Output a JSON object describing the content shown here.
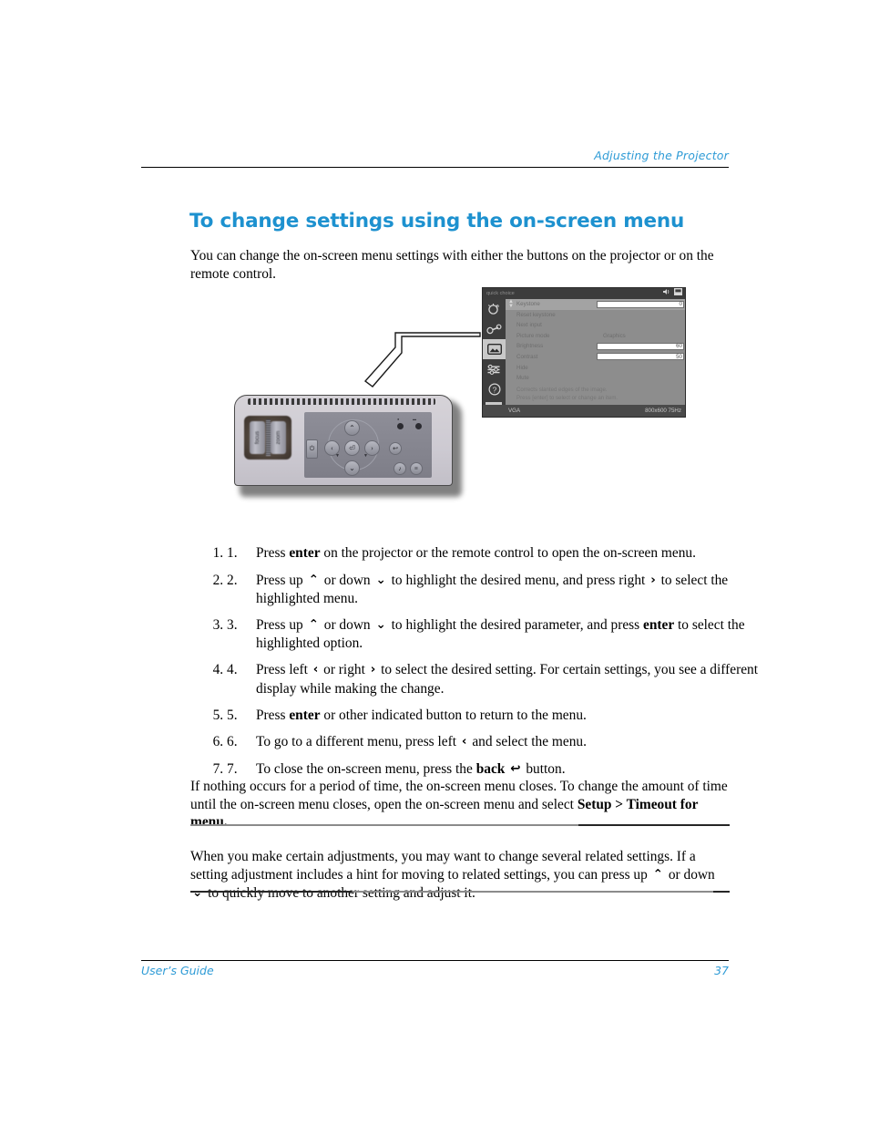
{
  "header": {
    "running_head": "Adjusting the Projector"
  },
  "section": {
    "title": "To change settings using the on-screen menu",
    "intro": "You can change the on-screen menu settings with either the buttons on the projector or on the remote control."
  },
  "figure": {
    "osd": {
      "title": "quick choice",
      "status_source": "VGA",
      "status_mode": "800x600 75Hz",
      "hint_line1": "Corrects slanted edges of the image.",
      "hint_line2": "Press [enter] to select or change an item.",
      "sidebar_icons": [
        "quick-choice-icon",
        "adjust-picture-icon",
        "picture-icon",
        "setup-icon",
        "help-icon",
        "hp-logo-icon"
      ],
      "titlebar_icons": [
        "volume-icon",
        "input-icon"
      ],
      "rows": [
        {
          "label": "Keystone",
          "type": "bar",
          "value": "0",
          "highlighted": true
        },
        {
          "label": "Reset keystone",
          "type": "none",
          "value": ""
        },
        {
          "label": "Next input",
          "type": "none",
          "value": ""
        },
        {
          "label": "Picture mode",
          "type": "option",
          "value": "Graphics"
        },
        {
          "label": "Brightness",
          "type": "bar",
          "value": "60"
        },
        {
          "label": "Contrast",
          "type": "bar",
          "value": "50"
        },
        {
          "label": "Hide",
          "type": "none",
          "value": ""
        },
        {
          "label": "Mute",
          "type": "none",
          "value": ""
        }
      ]
    },
    "projector": {
      "focus_label": "focus",
      "zoom_label": "zoom",
      "keystone_left_label": "▼",
      "keystone_right_label": "▼",
      "led_label_1": "●",
      "led_label_2": "▬",
      "power_button": "⏻",
      "up_button": "⌃",
      "down_button": "⌄",
      "left_button": "‹",
      "right_button": "›",
      "enter_button": "⏎",
      "back_button": "↩",
      "button_1": "♪",
      "button_2": "≡"
    }
  },
  "steps": [
    {
      "num": "1.",
      "parts": [
        {
          "t": "Press "
        },
        {
          "t": "enter",
          "bold": true
        },
        {
          "t": " on the projector or the remote control to open the on-screen menu."
        }
      ]
    },
    {
      "num": "2.",
      "parts": [
        {
          "t": "Press up "
        },
        {
          "t": "⌃",
          "glyph": "up-chevron-icon"
        },
        {
          "t": " or down "
        },
        {
          "t": "⌄",
          "glyph": "down-chevron-icon"
        },
        {
          "t": " to highlight the desired menu, and press right "
        },
        {
          "t": "›",
          "glyph": "right-chevron-icon"
        },
        {
          "t": " to select the highlighted menu."
        }
      ]
    },
    {
      "num": "3.",
      "parts": [
        {
          "t": "Press up "
        },
        {
          "t": "⌃",
          "glyph": "up-chevron-icon"
        },
        {
          "t": " or down "
        },
        {
          "t": "⌄",
          "glyph": "down-chevron-icon"
        },
        {
          "t": " to highlight the desired parameter, and press "
        },
        {
          "t": "enter",
          "bold": true
        },
        {
          "t": " to select the highlighted option."
        }
      ]
    },
    {
      "num": "4.",
      "parts": [
        {
          "t": "Press left "
        },
        {
          "t": "‹",
          "glyph": "left-chevron-icon"
        },
        {
          "t": " or right "
        },
        {
          "t": "›",
          "glyph": "right-chevron-icon"
        },
        {
          "t": " to select the desired setting. For certain settings, you see a different display while making the change."
        }
      ]
    },
    {
      "num": "5.",
      "parts": [
        {
          "t": "Press "
        },
        {
          "t": "enter",
          "bold": true
        },
        {
          "t": " or other indicated button to return to the menu."
        }
      ]
    },
    {
      "num": "6.",
      "parts": [
        {
          "t": "To go to a different menu, press left "
        },
        {
          "t": "‹",
          "glyph": "left-chevron-icon"
        },
        {
          "t": " and select the menu."
        }
      ]
    },
    {
      "num": "7.",
      "parts": [
        {
          "t": "To close the on-screen menu, press the "
        },
        {
          "t": "back",
          "bold": true
        },
        {
          "t": " "
        },
        {
          "t": "↩",
          "glyph": "back-arrow-icon"
        },
        {
          "t": " button."
        }
      ]
    }
  ],
  "closing": {
    "parts": [
      {
        "t": "If nothing occurs for a period of time, the on-screen menu closes. To change the amount of time until the on-screen menu closes, open the on-screen menu and select "
      },
      {
        "t": "Setup > Timeout for menu.",
        "bold": true
      }
    ]
  },
  "note": {
    "parts": [
      {
        "t": "When you make certain adjustments, you may want to change several related settings. If a setting adjustment includes a hint for moving to related settings, you can press up "
      },
      {
        "t": "⌃",
        "glyph": "up-chevron-icon"
      },
      {
        "t": " or down "
      },
      {
        "t": "⌄",
        "glyph": "down-chevron-icon"
      },
      {
        "t": " to quickly move to another setting and adjust it."
      }
    ]
  },
  "footer": {
    "left": "User’s Guide",
    "page_number": "37"
  },
  "colors": {
    "accent_blue": "#1d91cf",
    "header_blue": "#2e9bd6",
    "text_black": "#000000"
  }
}
